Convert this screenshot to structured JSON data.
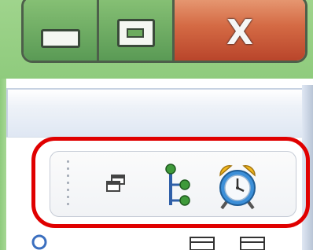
{
  "window": {
    "caption_buttons": [
      {
        "name": "minimize",
        "icon": "minimize-icon"
      },
      {
        "name": "maximize",
        "icon": "maximize-icon"
      },
      {
        "name": "close",
        "icon": "close-icon",
        "glyph": "X"
      }
    ],
    "chrome_color": "#9fd48c",
    "close_color": "#d46a44"
  },
  "quick_toolbar": {
    "highlight_color": "#e00000",
    "buttons": [
      {
        "name": "cascade",
        "icon": "cascade-windows-icon"
      },
      {
        "name": "tree",
        "icon": "tree-structure-icon"
      },
      {
        "name": "alarm",
        "icon": "alarm-clock-icon"
      }
    ]
  },
  "bottom_row": {
    "icons": [
      "search-icon",
      "panel-icon",
      "panel-icon"
    ]
  }
}
